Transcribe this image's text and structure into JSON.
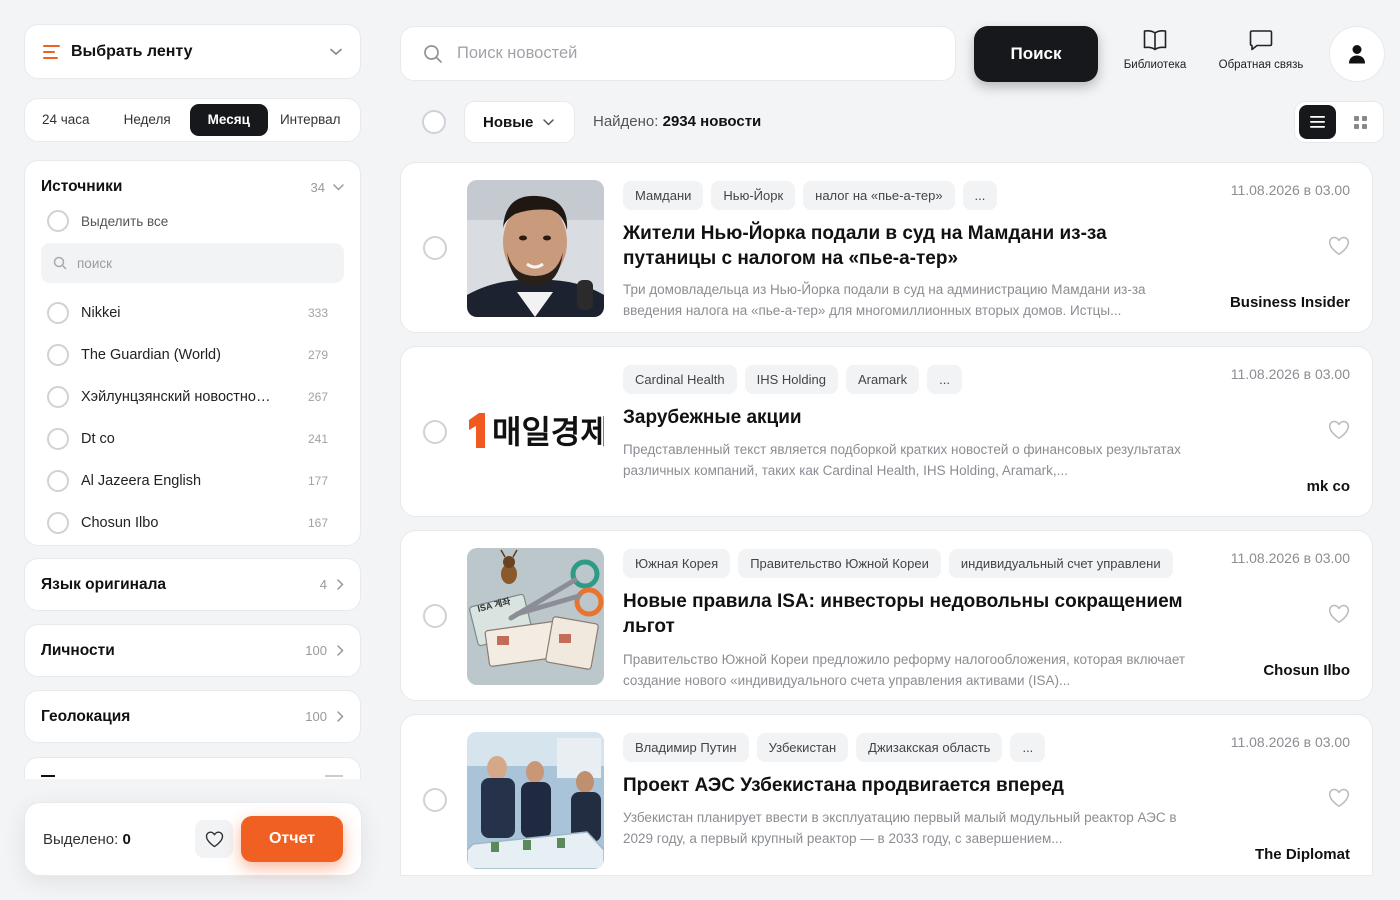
{
  "sidebar": {
    "feed_select_label": "Выбрать ленту",
    "periods": [
      "24 часа",
      "Неделя",
      "Месяц",
      "Интервал"
    ],
    "active_period": "Месяц",
    "sources": {
      "title": "Источники",
      "count": "34",
      "select_all": "Выделить все",
      "search_placeholder": "поиск",
      "items": [
        {
          "name": "Nikkei",
          "count": "333"
        },
        {
          "name": "The Guardian (World)",
          "count": "279"
        },
        {
          "name": "Хэйлунцзянский новостной по...",
          "count": "267"
        },
        {
          "name": "Dt co",
          "count": "241"
        },
        {
          "name": "Al Jazeera English",
          "count": "177"
        },
        {
          "name": "Chosun Ilbo",
          "count": "167"
        }
      ]
    },
    "facets": [
      {
        "title": "Язык оригинала",
        "count": "4"
      },
      {
        "title": "Личности",
        "count": "100"
      },
      {
        "title": "Геолокация",
        "count": "100"
      }
    ],
    "selected_label": "Выделено:",
    "selected_count": "0",
    "report_label": "Отчет"
  },
  "header": {
    "search_placeholder": "Поиск новостей",
    "search_button": "Поиск",
    "library_label": "Библиотека",
    "feedback_label": "Обратная связь"
  },
  "toolbar": {
    "sort_label": "Новые",
    "found_label": "Найдено:",
    "found_value": "2934 новости"
  },
  "news": [
    {
      "tags": [
        "Мамдани",
        "Нью-Йорк",
        "налог на «пье-а-тер»",
        "..."
      ],
      "title": "Жители Нью-Йорка подали в суд на Мамдани из-за путаницы с налогом на «пье-а-тер»",
      "desc": "Три домовладельца из Нью-Йорка подали в суд на администрацию Мамдани из-за введения налога на «пье-а-тер» для многомиллионных вторых домов. Истцы...",
      "date": "11.08.2026 в 03.00",
      "source": "Business Insider"
    },
    {
      "tags": [
        "Cardinal Health",
        "IHS Holding",
        "Aramark",
        "..."
      ],
      "title": "Зарубежные акции",
      "desc": "Представленный текст является подборкой кратких новостей о финансовых результатах различных компаний, таких как Cardinal Health, IHS Holding, Aramark,...",
      "date": "11.08.2026 в 03.00",
      "source": "mk co",
      "logo_text": "매일경제"
    },
    {
      "tags": [
        "Южная Корея",
        "Правительство Южной Кореи",
        "индивидуальный счет управлени"
      ],
      "title": "Новые правила ISA: инвесторы недовольны сокращением льгот",
      "desc": "Правительство Южной Кореи предложило реформу налогообложения, которая включает создание нового «индивидуального счета управления активами (ISA)...",
      "date": "11.08.2026 в 03.00",
      "source": "Chosun Ilbo",
      "image_text": "ISA 계좌"
    },
    {
      "tags": [
        "Владимир Путин",
        "Узбекистан",
        "Джизакская область",
        "..."
      ],
      "title": "Проект АЭС Узбекистана продвигается вперед",
      "desc": "Узбекистан планирует ввести в эксплуатацию первый малый модульный реактор АЭС в 2029 году, а первый крупный реактор — в 2033 году, с завершением...",
      "date": "11.08.2026 в 03.00",
      "source": "The Diplomat"
    }
  ],
  "colors": {
    "accent": "#f06022",
    "dark": "#16181b",
    "background": "#f3f4f6"
  }
}
